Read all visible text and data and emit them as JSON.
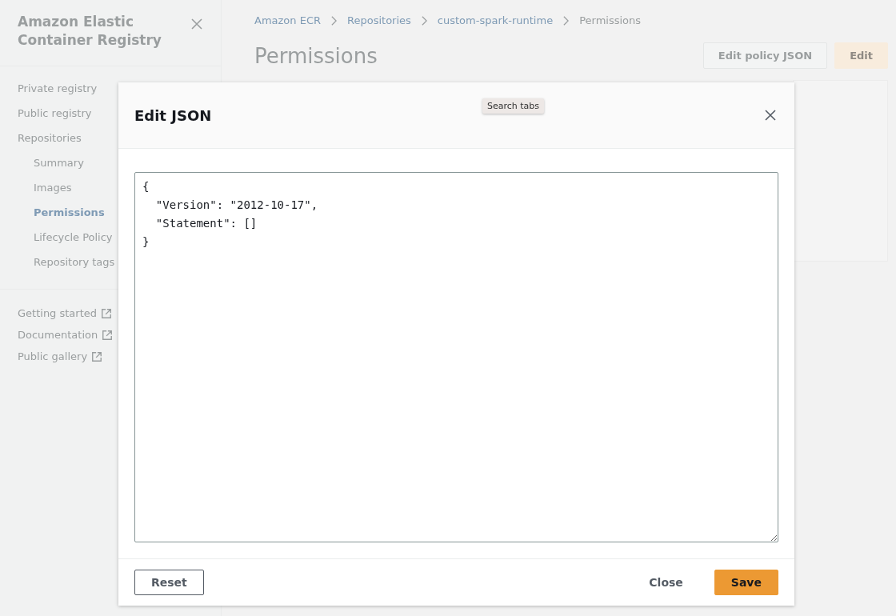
{
  "sidebar": {
    "title": "Amazon Elastic Container Registry",
    "items": [
      {
        "label": "Private registry",
        "selected": false
      },
      {
        "label": "Public registry",
        "selected": false
      },
      {
        "label": "Repositories",
        "selected": false,
        "children": [
          {
            "label": "Summary",
            "selected": false
          },
          {
            "label": "Images",
            "selected": false
          },
          {
            "label": "Permissions",
            "selected": true
          },
          {
            "label": "Lifecycle Policy",
            "selected": false
          },
          {
            "label": "Repository tags",
            "selected": false
          }
        ]
      }
    ],
    "links": [
      "Getting started",
      "Documentation",
      "Public gallery"
    ]
  },
  "breadcrumbs": [
    "Amazon ECR",
    "Repositories",
    "custom-spark-runtime",
    "Permissions"
  ],
  "page": {
    "title": "Permissions",
    "buttons": [
      {
        "label": "Edit policy JSON",
        "kind": "normal"
      },
      {
        "label": "Edit",
        "kind": "primary"
      }
    ]
  },
  "modal": {
    "title": "Edit JSON",
    "tooltip": "Search tabs",
    "editor_value": "{\n  \"Version\": \"2012-10-17\",\n  \"Statement\": []\n}",
    "buttons": [
      {
        "label": "Reset",
        "kind": "normal"
      },
      {
        "label": "Close",
        "kind": "link"
      },
      {
        "label": "Save",
        "kind": "primary"
      }
    ]
  }
}
